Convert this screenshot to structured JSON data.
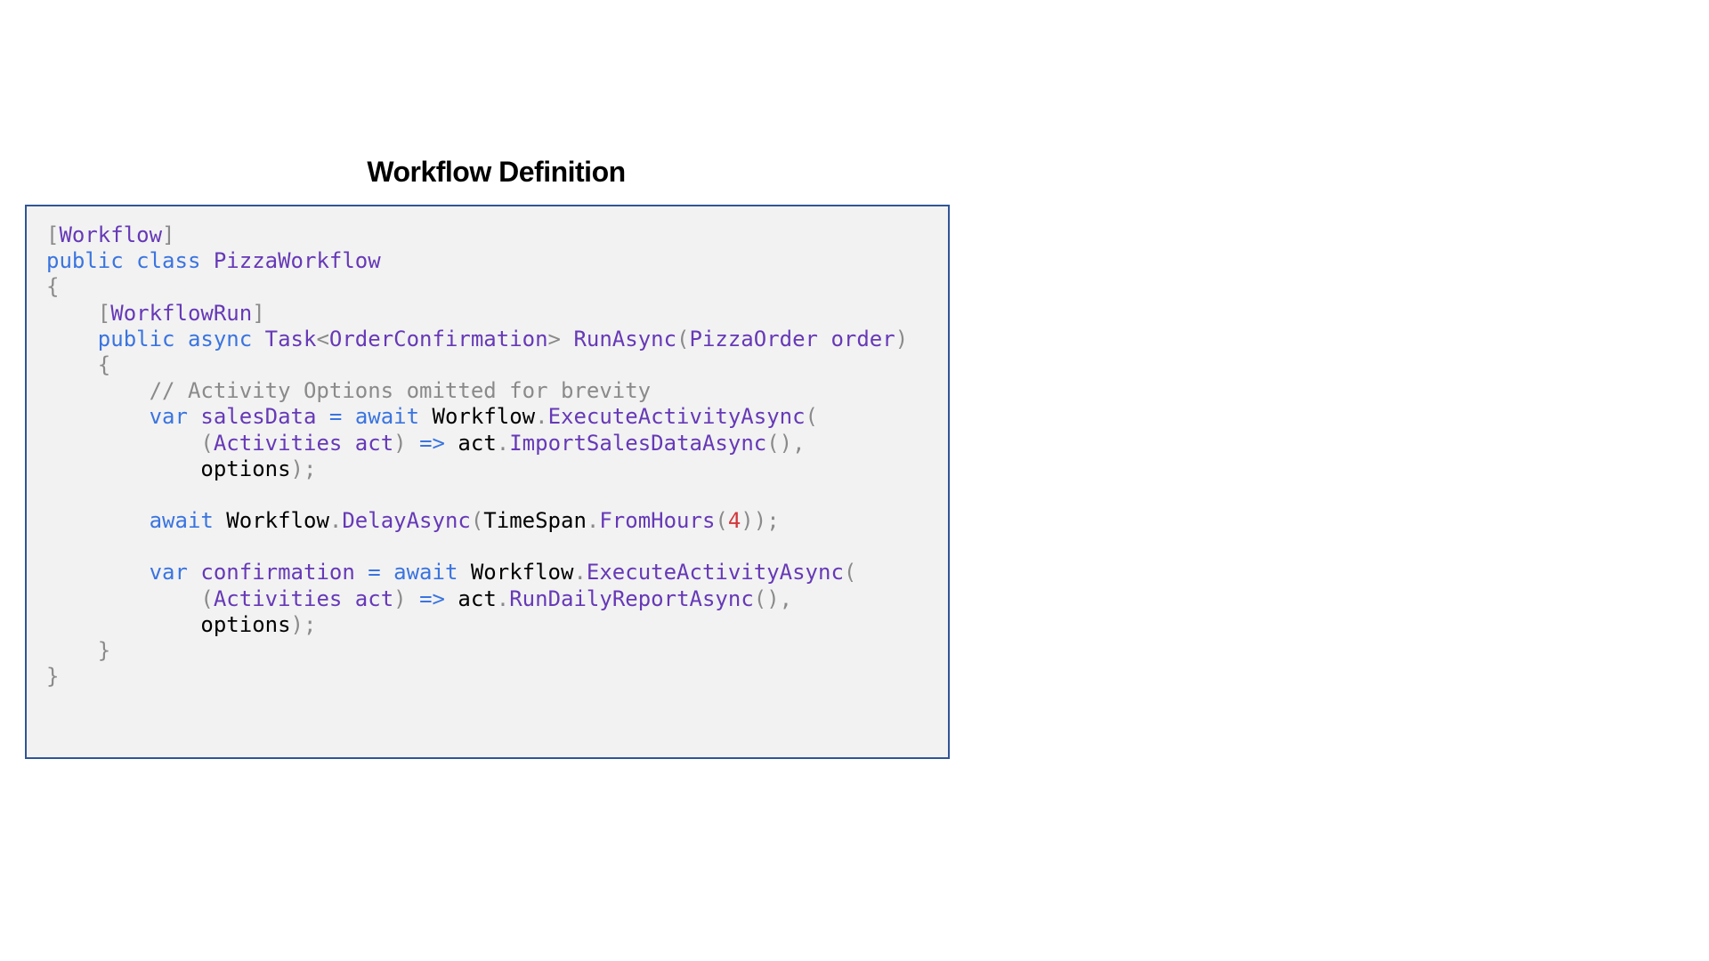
{
  "title": "Workflow Definition",
  "code": {
    "lines": [
      [
        {
          "t": "[",
          "s": "p"
        },
        {
          "t": "Workflow",
          "s": "a"
        },
        {
          "t": "]",
          "s": "p"
        }
      ],
      [
        {
          "t": "public",
          "s": "k"
        },
        {
          "t": " ",
          "s": "t"
        },
        {
          "t": "class",
          "s": "k"
        },
        {
          "t": " ",
          "s": "t"
        },
        {
          "t": "PizzaWorkflow",
          "s": "a"
        }
      ],
      [
        {
          "t": "{",
          "s": "p"
        }
      ],
      [
        {
          "t": "    ",
          "s": "t"
        },
        {
          "t": "[",
          "s": "p"
        },
        {
          "t": "WorkflowRun",
          "s": "a"
        },
        {
          "t": "]",
          "s": "p"
        }
      ],
      [
        {
          "t": "    ",
          "s": "t"
        },
        {
          "t": "public",
          "s": "k"
        },
        {
          "t": " ",
          "s": "t"
        },
        {
          "t": "async",
          "s": "k"
        },
        {
          "t": " ",
          "s": "t"
        },
        {
          "t": "Task",
          "s": "a"
        },
        {
          "t": "<",
          "s": "p"
        },
        {
          "t": "OrderConfirmation",
          "s": "a"
        },
        {
          "t": ">",
          "s": "p"
        },
        {
          "t": " ",
          "s": "t"
        },
        {
          "t": "RunAsync",
          "s": "a"
        },
        {
          "t": "(",
          "s": "p"
        },
        {
          "t": "PizzaOrder",
          "s": "a"
        },
        {
          "t": " ",
          "s": "t"
        },
        {
          "t": "order",
          "s": "a"
        },
        {
          "t": ")",
          "s": "p"
        }
      ],
      [
        {
          "t": "    ",
          "s": "t"
        },
        {
          "t": "{",
          "s": "p"
        }
      ],
      [
        {
          "t": "        ",
          "s": "t"
        },
        {
          "t": "// Activity Options omitted for brevity",
          "s": "c"
        }
      ],
      [
        {
          "t": "        ",
          "s": "t"
        },
        {
          "t": "var",
          "s": "k"
        },
        {
          "t": " ",
          "s": "t"
        },
        {
          "t": "salesData",
          "s": "v"
        },
        {
          "t": " ",
          "s": "t"
        },
        {
          "t": "=",
          "s": "k"
        },
        {
          "t": " ",
          "s": "t"
        },
        {
          "t": "await",
          "s": "k"
        },
        {
          "t": " ",
          "s": "t"
        },
        {
          "t": "Workflow",
          "s": "t"
        },
        {
          "t": ".",
          "s": "p"
        },
        {
          "t": "ExecuteActivityAsync",
          "s": "a"
        },
        {
          "t": "(",
          "s": "p"
        }
      ],
      [
        {
          "t": "            ",
          "s": "t"
        },
        {
          "t": "(",
          "s": "p"
        },
        {
          "t": "Activities",
          "s": "a"
        },
        {
          "t": " ",
          "s": "t"
        },
        {
          "t": "act",
          "s": "a"
        },
        {
          "t": ")",
          "s": "p"
        },
        {
          "t": " ",
          "s": "t"
        },
        {
          "t": "=>",
          "s": "k"
        },
        {
          "t": " ",
          "s": "t"
        },
        {
          "t": "act",
          "s": "t"
        },
        {
          "t": ".",
          "s": "p"
        },
        {
          "t": "ImportSalesDataAsync",
          "s": "a"
        },
        {
          "t": "(),",
          "s": "p"
        }
      ],
      [
        {
          "t": "            ",
          "s": "t"
        },
        {
          "t": "options",
          "s": "t"
        },
        {
          "t": ");",
          "s": "p"
        }
      ],
      [],
      [
        {
          "t": "        ",
          "s": "t"
        },
        {
          "t": "await",
          "s": "k"
        },
        {
          "t": " ",
          "s": "t"
        },
        {
          "t": "Workflow",
          "s": "t"
        },
        {
          "t": ".",
          "s": "p"
        },
        {
          "t": "DelayAsync",
          "s": "a"
        },
        {
          "t": "(",
          "s": "p"
        },
        {
          "t": "TimeSpan",
          "s": "t"
        },
        {
          "t": ".",
          "s": "p"
        },
        {
          "t": "FromHours",
          "s": "a"
        },
        {
          "t": "(",
          "s": "p"
        },
        {
          "t": "4",
          "s": "n"
        },
        {
          "t": "));",
          "s": "p"
        }
      ],
      [],
      [
        {
          "t": "        ",
          "s": "t"
        },
        {
          "t": "var",
          "s": "k"
        },
        {
          "t": " ",
          "s": "t"
        },
        {
          "t": "confirmation",
          "s": "v"
        },
        {
          "t": " ",
          "s": "t"
        },
        {
          "t": "=",
          "s": "k"
        },
        {
          "t": " ",
          "s": "t"
        },
        {
          "t": "await",
          "s": "k"
        },
        {
          "t": " ",
          "s": "t"
        },
        {
          "t": "Workflow",
          "s": "t"
        },
        {
          "t": ".",
          "s": "p"
        },
        {
          "t": "ExecuteActivityAsync",
          "s": "a"
        },
        {
          "t": "(",
          "s": "p"
        }
      ],
      [
        {
          "t": "            ",
          "s": "t"
        },
        {
          "t": "(",
          "s": "p"
        },
        {
          "t": "Activities",
          "s": "a"
        },
        {
          "t": " ",
          "s": "t"
        },
        {
          "t": "act",
          "s": "a"
        },
        {
          "t": ")",
          "s": "p"
        },
        {
          "t": " ",
          "s": "t"
        },
        {
          "t": "=>",
          "s": "k"
        },
        {
          "t": " ",
          "s": "t"
        },
        {
          "t": "act",
          "s": "t"
        },
        {
          "t": ".",
          "s": "p"
        },
        {
          "t": "RunDailyReportAsync",
          "s": "a"
        },
        {
          "t": "(),",
          "s": "p"
        }
      ],
      [
        {
          "t": "            ",
          "s": "t"
        },
        {
          "t": "options",
          "s": "t"
        },
        {
          "t": ");",
          "s": "p"
        }
      ],
      [
        {
          "t": "    ",
          "s": "t"
        },
        {
          "t": "}",
          "s": "p"
        }
      ],
      [
        {
          "t": "}",
          "s": "p"
        }
      ]
    ]
  }
}
